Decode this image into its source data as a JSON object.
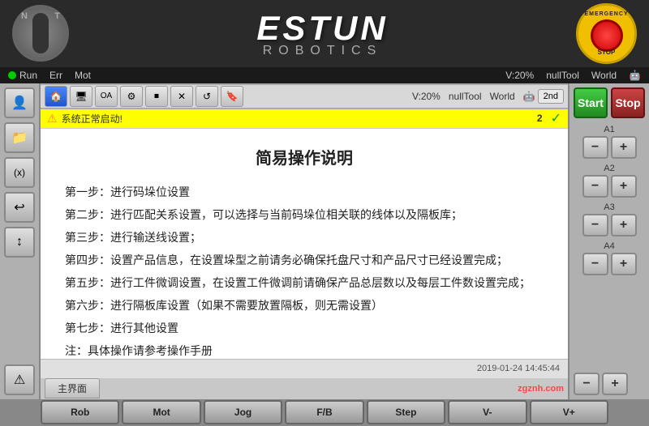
{
  "header": {
    "logo_estun": "ESTUN",
    "logo_robotics": "ROBOTICS",
    "key_label_n": "N",
    "key_label_t": "T",
    "emergency_text_top": "EMERGENCY",
    "emergency_text_bottom": "STOP"
  },
  "status_bar": {
    "run_label": "Run",
    "err_label": "Err",
    "mot_label": "Mot",
    "speed_label": "V:20%",
    "tool_label": "nullTool",
    "world_label": "World"
  },
  "toolbar": {
    "second_label": "2nd"
  },
  "warning": {
    "icon": "⚠",
    "text": "系统正常启动!",
    "num": "2",
    "check": "✓"
  },
  "main_content": {
    "title": "简易操作说明",
    "items": [
      "第一步：进行码垛位设置",
      "第二步：进行匹配关系设置，可以选择与当前码垛位相关联的线体以及隔板库；",
      "第三步：进行输送线设置；",
      "第四步：设置产品信息，在设置垛型之前请务必确保托盘尺寸和产品尺寸已经设置完成；",
      "第五步：进行工件微调设置，在设置工件微调前请确保产品总层数以及每层工件数设置完成；",
      "第六步：进行隔板库设置（如果不需要放置隔板，则无需设置）",
      "第七步：进行其他设置",
      "注：具体操作请参考操作手册"
    ]
  },
  "status_footer": {
    "timestamp": "2019-01-24  14:45:44"
  },
  "tab_bar": {
    "tab_label": "主界面"
  },
  "buttons": {
    "start": "Start",
    "stop": "Stop",
    "a1": "A1",
    "a2": "A2",
    "a3": "A3",
    "a4": "A4",
    "minus": "−",
    "plus": "+"
  },
  "bottom_buttons": {
    "rob": "Rob",
    "mot": "Mot",
    "jog": "Jog",
    "fb": "F/B",
    "step": "Step",
    "v_minus": "V-",
    "v_plus": "V+"
  },
  "watermark": "zgznh.com",
  "sidebar_icons": {
    "home": "🏠",
    "camera": "📷",
    "settings": "⚙",
    "stop": "⏹",
    "cross": "✕",
    "folder": "📁",
    "joystick": "🕹",
    "expression": "(x)",
    "arrow": "↩",
    "move": "↕",
    "warning": "⚠"
  }
}
